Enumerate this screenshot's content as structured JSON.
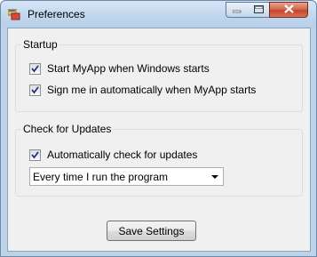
{
  "window": {
    "title": "Preferences",
    "icon": "app-window-icon",
    "controls": {
      "minimize": "minimize-icon",
      "maximize": "maximize-icon",
      "close": "close-icon"
    }
  },
  "startup": {
    "legend": "Startup",
    "options": [
      {
        "label": "Start MyApp when Windows starts",
        "checked": true
      },
      {
        "label": "Sign me in automatically when MyApp starts",
        "checked": true
      }
    ]
  },
  "updates": {
    "legend": "Check for Updates",
    "auto_check": {
      "label": "Automatically check for updates",
      "checked": true
    },
    "frequency": {
      "selected": "Every time I run the program"
    }
  },
  "actions": {
    "save_label": "Save Settings"
  },
  "colors": {
    "titlebar": "#c3d8ee",
    "client": "#f0f0f0",
    "close_button": "#c2452a",
    "check_mark": "#26318c"
  }
}
